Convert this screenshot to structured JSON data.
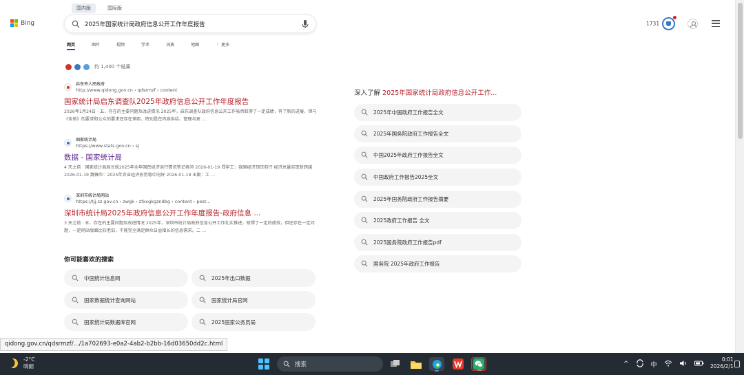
{
  "header": {
    "region_tabs": [
      {
        "label": "国内版",
        "active": true
      },
      {
        "label": "国际版",
        "active": false
      }
    ],
    "logo_text": "Bing",
    "search_query": "2025年国家统计局政府信息公开工作年度报告",
    "rewards_points": "1731"
  },
  "nav_tabs": [
    {
      "label": "网页",
      "active": true
    },
    {
      "label": "图片",
      "active": false
    },
    {
      "label": "视频",
      "active": false
    },
    {
      "label": "学术",
      "active": false
    },
    {
      "label": "词典",
      "active": false
    },
    {
      "label": "地图",
      "active": false
    },
    {
      "label": "更多",
      "active": false
    }
  ],
  "results_count": "约 1,400 个结果",
  "results": [
    {
      "site_name": "启东市人民政府",
      "url": "http://www.qidong.gov.cn › qdsrmzf › content",
      "title": "国家统计局启东调查队2025年政府信息公开工作年度报告",
      "snippet": "2026年1月24日 · 五、存在的主要问题及改进情况 2025年，启东调查队政府信息公开工作虽然取得了一定成绩，有了新的进展，但与《条例》的要求和公众的要求还存在差距，特别是在内容供给、管理与更 …",
      "visited": false,
      "favicon_color": "#c9372c"
    },
    {
      "site_name": "国家统计局",
      "url": "https://www.stats.gov.cn › sj",
      "title": "数据 - 国家统计局",
      "snippet": "4 天之前 · 国家统计局局长就2025年全年国民经济运行情况答记者问 2026-01-19 郑宇工：我国经济顶压前行 经济总量实现新跨越 2026-01-19 魏锋华：2025年农业经济形势稳中向好 2026-01-19 王勤：工 …",
      "visited": true,
      "favicon_color": "#2f6fcf"
    },
    {
      "site_name": "深圳市统计局网站",
      "url": "https://tjj.sz.gov.cn › zwgk › zfxxgkgzndbg › content › post...",
      "title": "深圳市统计局2025年政府信息公开工作年度报告-政府信息 ...",
      "snippet": "3 天之前 · 五、存在的主要问题及改进情况 2025年，深圳市统计局政府信息公开工作扎实推进，取得了一定的成效，但还存在一定问题，一是网站版面比较老旧，不能完全满足群众日益增长的信息需求。二 …",
      "visited": false,
      "favicon_color": "#2f6fcf"
    }
  ],
  "related": {
    "title": "你可能喜欢的搜索",
    "items": [
      "中国统计信息网",
      "2025年出口数据",
      "国家数据统计查询网站",
      "国家统计局官网",
      "国家统计局数据库官网",
      "2025国家公务员局"
    ]
  },
  "deep_dive": {
    "prefix": "深入了解 ",
    "highlight": "2025年国家统计局政府信息公开工作...",
    "items": [
      "2025年中国政府工作报告全文",
      "2025年国务院政府工作报告全文",
      "中国2025年政府工作报告全文",
      "中国政府工作报告2025全文",
      "2025年国务院政府工作报告摘要",
      "2025政府工作报告 全文",
      "2025国务院政府工作报告pdf",
      "国务院 2025年政府工作报告"
    ]
  },
  "status_url": "qidong.gov.cn/qdsrmzf/.../1a702693-e0a2-4ab2-b2bb-16d03650dd2c.html",
  "taskbar": {
    "weather_temp": "-2°C",
    "weather_desc": "晴朗",
    "search_placeholder": "搜索",
    "ime": "中",
    "time": "0:01",
    "date": "2026/2/1"
  }
}
